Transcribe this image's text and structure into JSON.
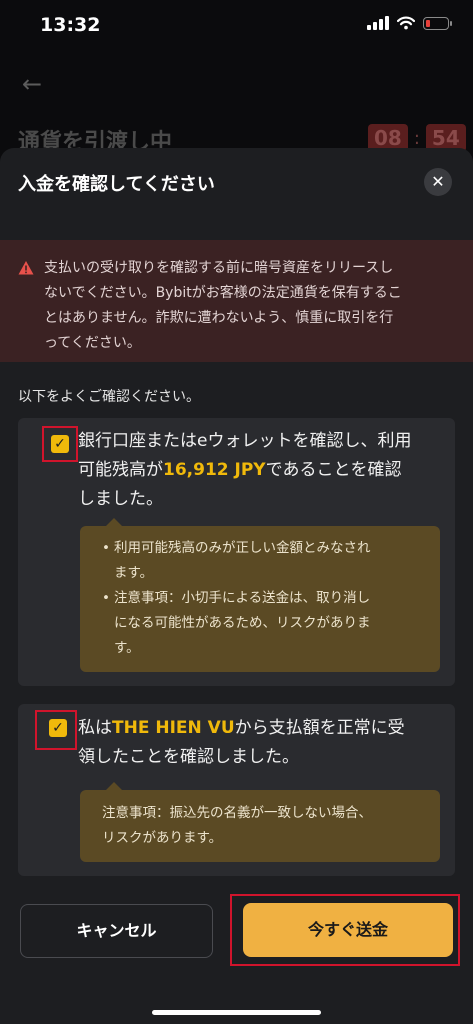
{
  "status_bar": {
    "time": "13:32"
  },
  "background": {
    "title": "通貨を引渡し中",
    "timer_minutes": "08",
    "timer_separator": ":",
    "timer_seconds": "54"
  },
  "dialog": {
    "title": "入金を確認してください",
    "warning_lines": [
      "支払いの受け取りを確認する前に暗号資産をリリースし",
      "ないでください。Bybitがお客様の法定通貨を保有するこ",
      "とはありません。詐欺に遭わないよう、慎重に取引を行",
      "ってください。"
    ],
    "confirm_note": "以下をよくご確認ください。",
    "check1": {
      "text_line1": "銀行口座またはeウォレットを確認し、利用",
      "text_prefix": "可能残高が",
      "amount": "16,912 JPY",
      "text_suffix": "であることを確認",
      "text_line3": "しました。",
      "tips": [
        [
          "利用可能残高のみが正しい金額とみなされ",
          "ます。"
        ],
        [
          "注意事項：小切手による送金は、取り消し",
          "になる可能性があるため、リスクがありま",
          "す。"
        ]
      ]
    },
    "check2": {
      "text_prefix": "私は",
      "name": "THE HIEN VU",
      "text_suffix": "から支払額を正常に受",
      "text_line2": "領したことを確認しました。",
      "tip_lines": [
        "注意事項：振込先の名義が一致しない場合、",
        "リスクがあります。"
      ]
    },
    "cancel_label": "キャンセル",
    "send_label": "今すぐ送金"
  },
  "colors": {
    "accent": "#f0b90b",
    "button": "#f0b142",
    "warning_bg": "#3b2223",
    "highlight_box": "#d0142c"
  }
}
